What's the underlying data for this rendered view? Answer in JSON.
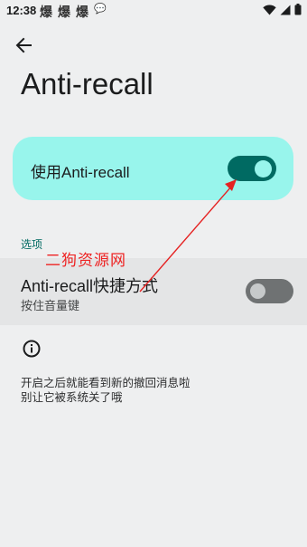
{
  "status_bar": {
    "time": "12:38",
    "notifications": [
      "爆",
      "爆",
      "爆",
      "💬"
    ]
  },
  "page": {
    "title": "Anti-recall"
  },
  "main_toggle": {
    "label": "使用Anti-recall",
    "enabled": true
  },
  "section": {
    "header": "选项"
  },
  "shortcut": {
    "title": "Anti-recall快捷方式",
    "subtitle": "按住音量键",
    "enabled": false
  },
  "info": {
    "icon": "info-icon",
    "text": "开启之后就能看到新的撤回消息啦\n别让它被系统关了哦"
  },
  "annotation": {
    "watermark": "二狗资源网",
    "arrow_color": "#e52222"
  },
  "colors": {
    "accent": "#006a62",
    "card": "#98f5ec",
    "background": "#eeeff0"
  }
}
